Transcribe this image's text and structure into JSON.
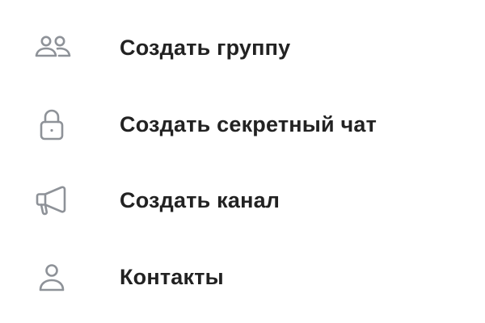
{
  "colors": {
    "background": "#ffffff",
    "text": "#222222",
    "icon": "#8e9298"
  },
  "menu": {
    "items": [
      {
        "label": "Создать группу",
        "icon": "people-icon"
      },
      {
        "label": "Создать секретный чат",
        "icon": "lock-icon"
      },
      {
        "label": "Создать канал",
        "icon": "megaphone-icon"
      },
      {
        "label": "Контакты",
        "icon": "person-icon"
      }
    ]
  }
}
